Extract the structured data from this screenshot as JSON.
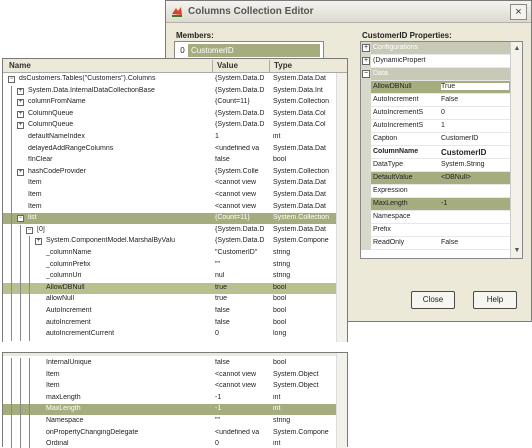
{
  "editor": {
    "title": "Columns Collection Editor",
    "members_label": "Members:",
    "member_index": "0",
    "member_name": "CustomerID",
    "properties_label": "CustomerID Properties:",
    "close_label": "Close",
    "help_label": "Help",
    "close_x": "×",
    "properties": [
      {
        "name": "Configurations",
        "value": "",
        "kind": "cat",
        "expand": "+"
      },
      {
        "name": "(DynamicPropert",
        "value": "",
        "kind": "item",
        "expand": "+"
      },
      {
        "name": "Data",
        "value": "",
        "kind": "cat",
        "expand": "−"
      },
      {
        "name": "AllowDBNull",
        "value": "True",
        "kind": "sel"
      },
      {
        "name": "AutoIncrement",
        "value": "False",
        "kind": "item"
      },
      {
        "name": "AutoIncrementS",
        "value": "0",
        "kind": "item"
      },
      {
        "name": "AutoIncrementS",
        "value": "1",
        "kind": "item"
      },
      {
        "name": "Caption",
        "value": "CustomerID",
        "kind": "item"
      },
      {
        "name": "ColumnName",
        "value": "CustomerID",
        "kind": "bold"
      },
      {
        "name": "DataType",
        "value": "System.String",
        "kind": "item"
      },
      {
        "name": "DefaultValue",
        "value": "<DBNull>",
        "kind": "hl"
      },
      {
        "name": "Expression",
        "value": "",
        "kind": "item"
      },
      {
        "name": "MaxLength",
        "value": "-1",
        "kind": "hl"
      },
      {
        "name": "Namespace",
        "value": "",
        "kind": "item"
      },
      {
        "name": "Prefix",
        "value": "",
        "kind": "item"
      },
      {
        "name": "ReadOnly",
        "value": "False",
        "kind": "item"
      }
    ]
  },
  "watch": {
    "headers": {
      "name": "Name",
      "value": "Value",
      "type": "Type"
    },
    "rows": [
      {
        "indent": 0,
        "expand": "−",
        "name": "dsCustomers.Tables(\"Customers\").Columns",
        "value": "{System.Data.D",
        "type": "System.Data.Dat"
      },
      {
        "indent": 1,
        "expand": "+",
        "name": "System.Data.InternalDataCollectionBase",
        "value": "{System.Data.D",
        "type": "System.Data.Int"
      },
      {
        "indent": 1,
        "expand": "+",
        "name": "columnFromName",
        "value": "{Count=11}",
        "type": "System.Collection"
      },
      {
        "indent": 1,
        "expand": "+",
        "name": "ColumnQueue",
        "value": "{System.Data.D",
        "type": "System.Data.Col"
      },
      {
        "indent": 1,
        "expand": "+",
        "name": "ColumnQueue",
        "value": "{System.Data.D",
        "type": "System.Data.Col"
      },
      {
        "indent": 1,
        "expand": "",
        "name": "defaultNameIndex",
        "value": "1",
        "type": "int"
      },
      {
        "indent": 1,
        "expand": "",
        "name": "delayedAddRangeColumns",
        "value": "<undefined va",
        "type": "System.Data.Dat"
      },
      {
        "indent": 1,
        "expand": "",
        "name": "fInClear",
        "value": "false",
        "type": "bool"
      },
      {
        "indent": 1,
        "expand": "+",
        "name": "hashCodeProvider",
        "value": "{System.Colle",
        "type": "System.Collection"
      },
      {
        "indent": 1,
        "expand": "",
        "name": "Item",
        "value": "<cannot view",
        "type": "System.Data.Dat"
      },
      {
        "indent": 1,
        "expand": "",
        "name": "Item",
        "value": "<cannot view",
        "type": "System.Data.Dat"
      },
      {
        "indent": 1,
        "expand": "",
        "name": "Item",
        "value": "<cannot view",
        "type": "System.Data.Dat"
      },
      {
        "indent": 1,
        "expand": "−",
        "name": "list",
        "value": "{Count=11}",
        "type": "System.Collection",
        "sel": true
      },
      {
        "indent": 2,
        "expand": "−",
        "name": "[0]",
        "value": "{System.Data.D",
        "type": "System.Data.Dat"
      },
      {
        "indent": 3,
        "expand": "+",
        "name": "System.ComponentModel.MarshalByValu",
        "value": "{System.Data.D",
        "type": "System.Compone"
      },
      {
        "indent": 3,
        "expand": "",
        "name": "_columnName",
        "value": "\"CustomerID\"",
        "type": "string"
      },
      {
        "indent": 3,
        "expand": "",
        "name": "_columnPrefix",
        "value": "\"\"",
        "type": "string"
      },
      {
        "indent": 3,
        "expand": "",
        "name": "_columnUri",
        "value": "nul",
        "type": "string"
      },
      {
        "indent": 3,
        "expand": "",
        "name": "AllowDBNull",
        "value": "true",
        "type": "bool",
        "hl": true
      },
      {
        "indent": 3,
        "expand": "",
        "name": "allowNull",
        "value": "true",
        "type": "bool"
      },
      {
        "indent": 3,
        "expand": "",
        "name": "AutoIncrement",
        "value": "false",
        "type": "bool"
      },
      {
        "indent": 3,
        "expand": "",
        "name": "autoIncrement",
        "value": "false",
        "type": "bool"
      },
      {
        "indent": 3,
        "expand": "",
        "name": "autoIncrementCurrent",
        "value": "0",
        "type": "long"
      }
    ],
    "rows2": [
      {
        "indent": 3,
        "name": "InternalUnique",
        "value": "false",
        "type": "bool"
      },
      {
        "indent": 3,
        "name": "Item",
        "value": "<cannot view",
        "type": "System.Object"
      },
      {
        "indent": 3,
        "name": "Item",
        "value": "<cannot view",
        "type": "System.Object"
      },
      {
        "indent": 3,
        "name": "maxLength",
        "value": "-1",
        "type": "int"
      },
      {
        "indent": 3,
        "name": "MaxLength",
        "value": "-1",
        "type": "int",
        "sel": true
      },
      {
        "indent": 3,
        "name": "Namespace",
        "value": "\"\"",
        "type": "string"
      },
      {
        "indent": 3,
        "name": "onPropertyChangingDelegate",
        "value": "<undefined va",
        "type": "System.Compone"
      },
      {
        "indent": 3,
        "name": "Ordinal",
        "value": "0",
        "type": "int"
      }
    ]
  },
  "colors": {
    "accent": "#a5ad7f",
    "chrome": "#ece9d8",
    "category": "#c9c9b8"
  },
  "icons": {
    "app": "app-icon",
    "close": "close-icon",
    "expand": "expand-icon",
    "collapse": "collapse-icon"
  }
}
